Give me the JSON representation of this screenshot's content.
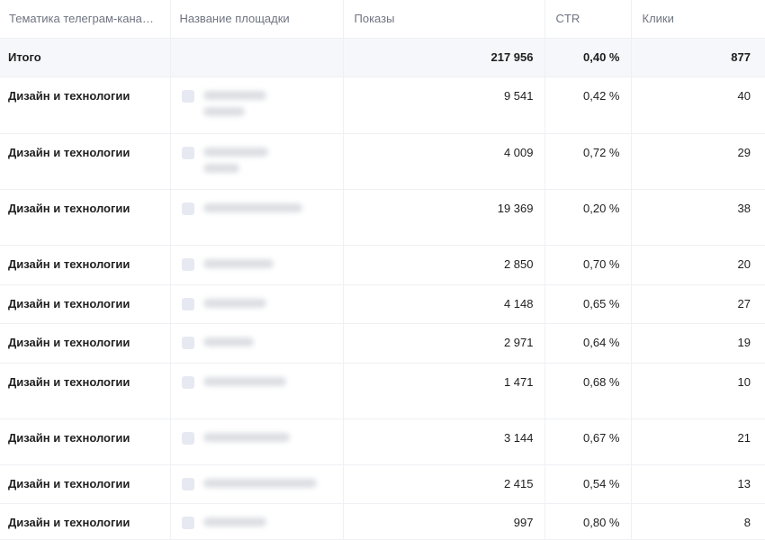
{
  "columns": [
    "Тематика телеграм-кана…",
    "Название площадки",
    "Показы",
    "CTR",
    "Клики"
  ],
  "total": {
    "label": "Итого",
    "impressions": "217 956",
    "ctr": "0,40 %",
    "clicks": "877"
  },
  "rows": [
    {
      "topic": "Дизайн и технологии",
      "impressions": "9 541",
      "ctr": "0,42 %",
      "clicks": "40"
    },
    {
      "topic": "Дизайн и технологии",
      "impressions": "4 009",
      "ctr": "0,72 %",
      "clicks": "29"
    },
    {
      "topic": "Дизайн и технологии",
      "impressions": "19 369",
      "ctr": "0,20 %",
      "clicks": "38"
    },
    {
      "topic": "Дизайн и технологии",
      "impressions": "2 850",
      "ctr": "0,70 %",
      "clicks": "20"
    },
    {
      "topic": "Дизайн и технологии",
      "impressions": "4 148",
      "ctr": "0,65 %",
      "clicks": "27"
    },
    {
      "topic": "Дизайн и технологии",
      "impressions": "2 971",
      "ctr": "0,64 %",
      "clicks": "19"
    },
    {
      "topic": "Дизайн и технологии",
      "impressions": "1 471",
      "ctr": "0,68 %",
      "clicks": "10"
    },
    {
      "topic": "Дизайн и технологии",
      "impressions": "3 144",
      "ctr": "0,67 %",
      "clicks": "21"
    },
    {
      "topic": "Дизайн и технологии",
      "impressions": "2 415",
      "ctr": "0,54 %",
      "clicks": "13"
    },
    {
      "topic": "Дизайн и технологии",
      "impressions": "997",
      "ctr": "0,80 %",
      "clicks": "8"
    }
  ]
}
